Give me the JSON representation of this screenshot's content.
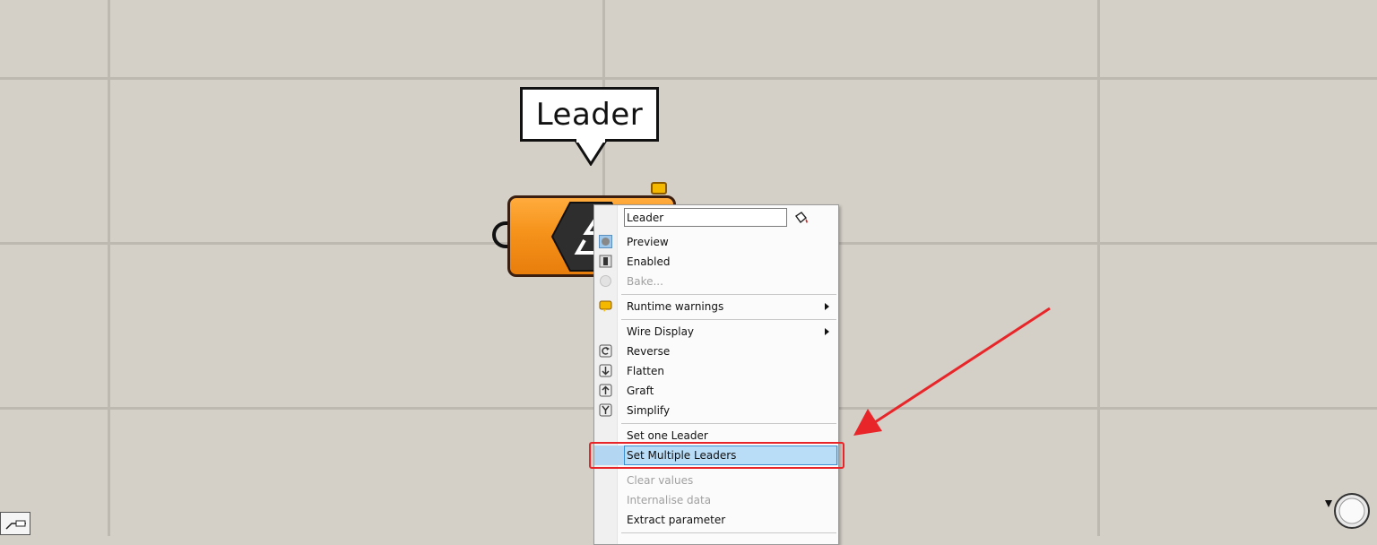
{
  "tooltip": {
    "text": "Leader"
  },
  "component": {
    "icon": "leader-component-icon"
  },
  "menu": {
    "name_value": "Leader",
    "items": {
      "preview": "Preview",
      "enabled": "Enabled",
      "bake": "Bake...",
      "runtime_warnings": "Runtime warnings",
      "wire_display": "Wire Display",
      "reverse": "Reverse",
      "flatten": "Flatten",
      "graft": "Graft",
      "simplify": "Simplify",
      "set_one_leader": "Set one Leader",
      "set_multiple_leaders": "Set Multiple Leaders",
      "clear_values": "Clear values",
      "internalise_data": "Internalise data",
      "extract_parameter": "Extract parameter"
    }
  },
  "colors": {
    "canvas": "#d4d0c8",
    "component_orange": "#f5931b",
    "highlight_blue": "#b3d7f3",
    "annotation_red": "#e8262a"
  }
}
